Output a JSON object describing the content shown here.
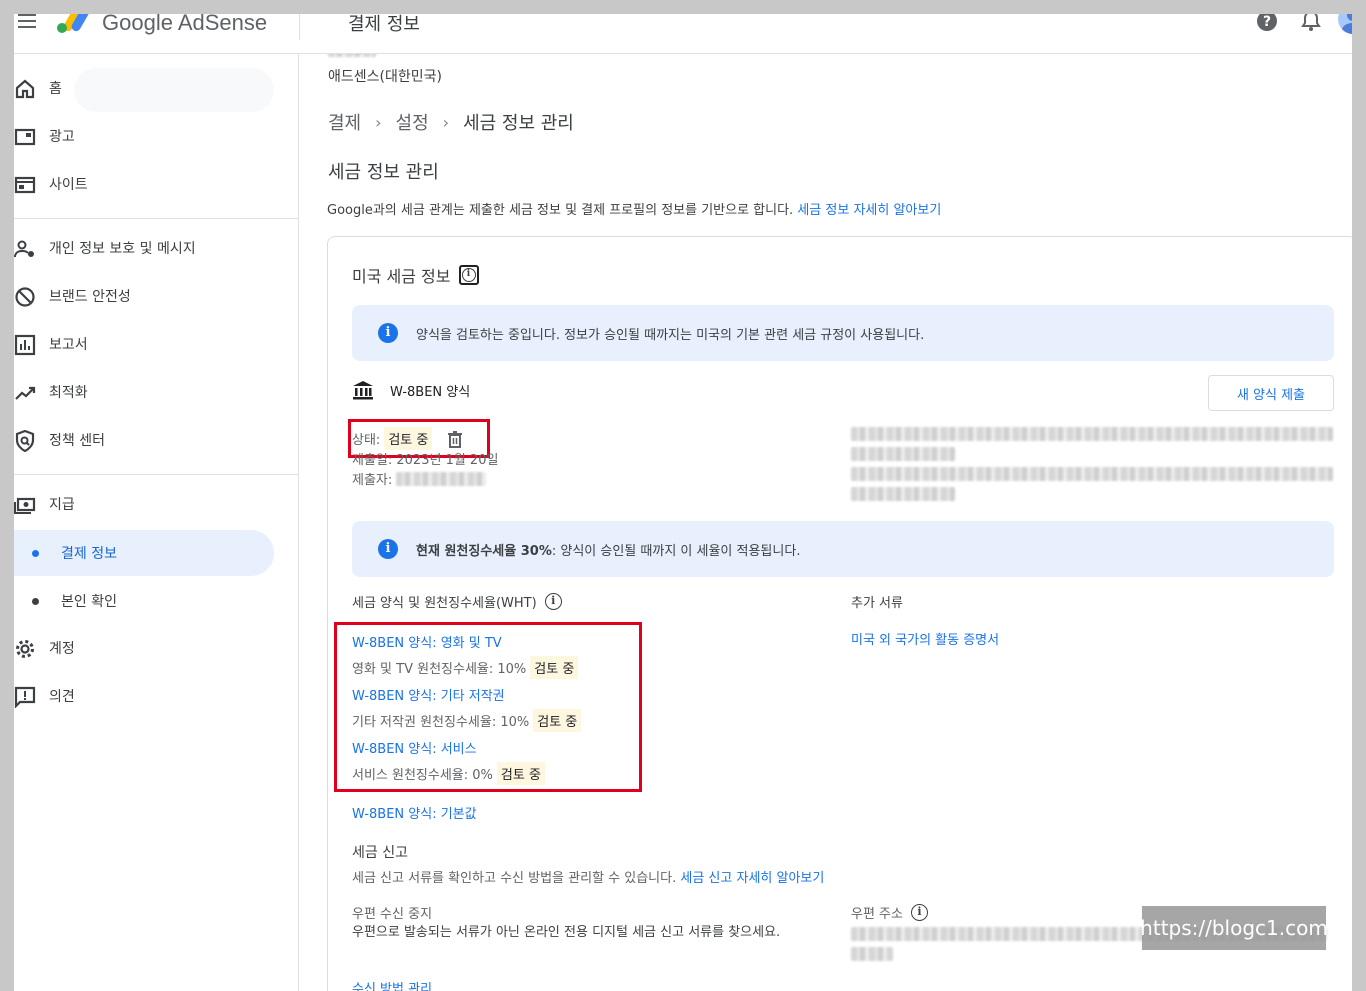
{
  "header": {
    "brand": "Google AdSense",
    "page_title": "결제 정보"
  },
  "sidebar": {
    "items": [
      {
        "label": "홈",
        "icon": "home-icon"
      },
      {
        "label": "광고",
        "icon": "ads-icon"
      },
      {
        "label": "사이트",
        "icon": "sites-icon"
      },
      {
        "label": "개인 정보 보호 및 메시지",
        "icon": "privacy-icon"
      },
      {
        "label": "브랜드 안전성",
        "icon": "block-icon"
      },
      {
        "label": "보고서",
        "icon": "reports-icon"
      },
      {
        "label": "최적화",
        "icon": "trending-icon"
      },
      {
        "label": "정책 센터",
        "icon": "policy-icon"
      },
      {
        "label": "지급",
        "icon": "payments-icon"
      },
      {
        "label": "계정",
        "icon": "gear-icon"
      },
      {
        "label": "의견",
        "icon": "feedback-icon"
      }
    ],
    "sub_items": [
      {
        "label": "결제 정보",
        "active": true
      },
      {
        "label": "본인 확인",
        "active": false
      }
    ]
  },
  "main": {
    "account_label": "애드센스(대한민국)",
    "breadcrumb": [
      "결제",
      "설정",
      "세금 정보 관리"
    ],
    "section_title": "세금 정보 관리",
    "intro_text": "Google과의 세금 관계는 제출한 세금 정보 및 결제 프로필의 정보를 기반으로 합니다.",
    "intro_link": "세금 정보 자세히 알아보기",
    "card": {
      "title": "미국 세금 정보",
      "banner1": "양식을 검토하는 중입니다. 정보가 승인될 때까지는 미국의 기본 관련 세금 규정이 사용됩니다.",
      "form_name": "W-8BEN 양식",
      "new_form_button": "새 양식 제출",
      "status_label": "상태:",
      "status_value": "검토 중",
      "submitted_date": "제출일: 2023년 1월 20일",
      "submitter_label": "제출자:",
      "banner2_bold": "현재 원천징수세율 30%",
      "banner2_rest": ": 양식이 승인될 때까지 이 세율이 적용됩니다.",
      "wht_title": "세금 양식 및 원천징수세율(WHT)",
      "extra_docs_title": "추가 서류",
      "extra_docs_link": "미국 외 국가의 활동 증명서",
      "wht_forms": [
        {
          "link": "W-8BEN 양식: 영화 및 TV",
          "rate": "영화 및 TV 원천징수세율: 10%",
          "status": "검토 중"
        },
        {
          "link": "W-8BEN 양식: 기타 저작권",
          "rate": "기타 저작권 원천징수세율: 10%",
          "status": "검토 중"
        },
        {
          "link": "W-8BEN 양식: 서비스",
          "rate": "서비스 원천징수세율: 0%",
          "status": "검토 중"
        }
      ],
      "default_form_link": "W-8BEN 양식: 기본값",
      "tax_report_title": "세금 신고",
      "tax_report_desc": "세금 신고 서류를 확인하고 수신 방법을 관리할 수 있습니다.",
      "tax_report_link": "세금 신고 자세히 알아보기",
      "mail_stop_title": "우편 수신 중지",
      "mail_stop_desc": "우편으로 발송되는 서류가 아닌 온라인 전용 디지털 세금 신고 서류를 찾으세요.",
      "postal_address_title": "우편 주소",
      "manage_link": "수신 방법 관리"
    }
  },
  "watermark": "https://blogc1.com",
  "colors": {
    "accent": "#1a73e8",
    "highlight_box": "#e0001b",
    "chip_bg": "#fef7e0",
    "banner_bg": "#e8f0fe"
  }
}
